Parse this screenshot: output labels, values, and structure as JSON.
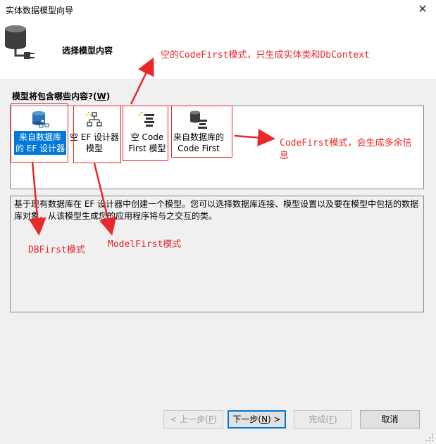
{
  "window": {
    "title": "实体数据模型向导",
    "close_glyph": "✕"
  },
  "header": {
    "title": "选择模型内容"
  },
  "section": {
    "label_prefix": "模型将包含哪些内容?(",
    "hotkey": "W",
    "label_suffix": ")"
  },
  "tiles": [
    {
      "line1": "来自数据库",
      "line2": "的 EF 设计器",
      "icon": "database-designer-icon",
      "selected": true
    },
    {
      "line1": "空 EF 设计器",
      "line2": "模型",
      "icon": "empty-designer-icon",
      "selected": false
    },
    {
      "line1": "空 Code",
      "line2": "First 模型",
      "icon": "empty-codefirst-icon",
      "selected": false
    },
    {
      "line1": "来自数据库的",
      "line2": "Code First",
      "icon": "database-codefirst-icon",
      "selected": false
    }
  ],
  "description": "基于现有数据库在 EF 设计器中创建一个模型。您可以选择数据库连接、模型设置以及要在模型中包括的数据库对象。从该模型生成您的应用程序将与之交互的类。",
  "annotations": {
    "top": "空的CodeFirst模式，只生成实体类和DbContext",
    "right_line1": "CodeFirst模式，会生成多余信",
    "right_line2": "息",
    "dbfirst": "DBFirst模式",
    "modelfirst": "ModelFirst模式"
  },
  "buttons": {
    "prev": {
      "label": "< 上一步(",
      "key": "P",
      "end": ")"
    },
    "next": {
      "label": "下一步(",
      "key": "N",
      "end": ") >"
    },
    "finish": {
      "label": "完成(",
      "key": "F",
      "end": ")"
    },
    "cancel": {
      "label": "取消"
    }
  },
  "colors": {
    "annotation": "#e8282b",
    "selection": "#0078d7"
  }
}
